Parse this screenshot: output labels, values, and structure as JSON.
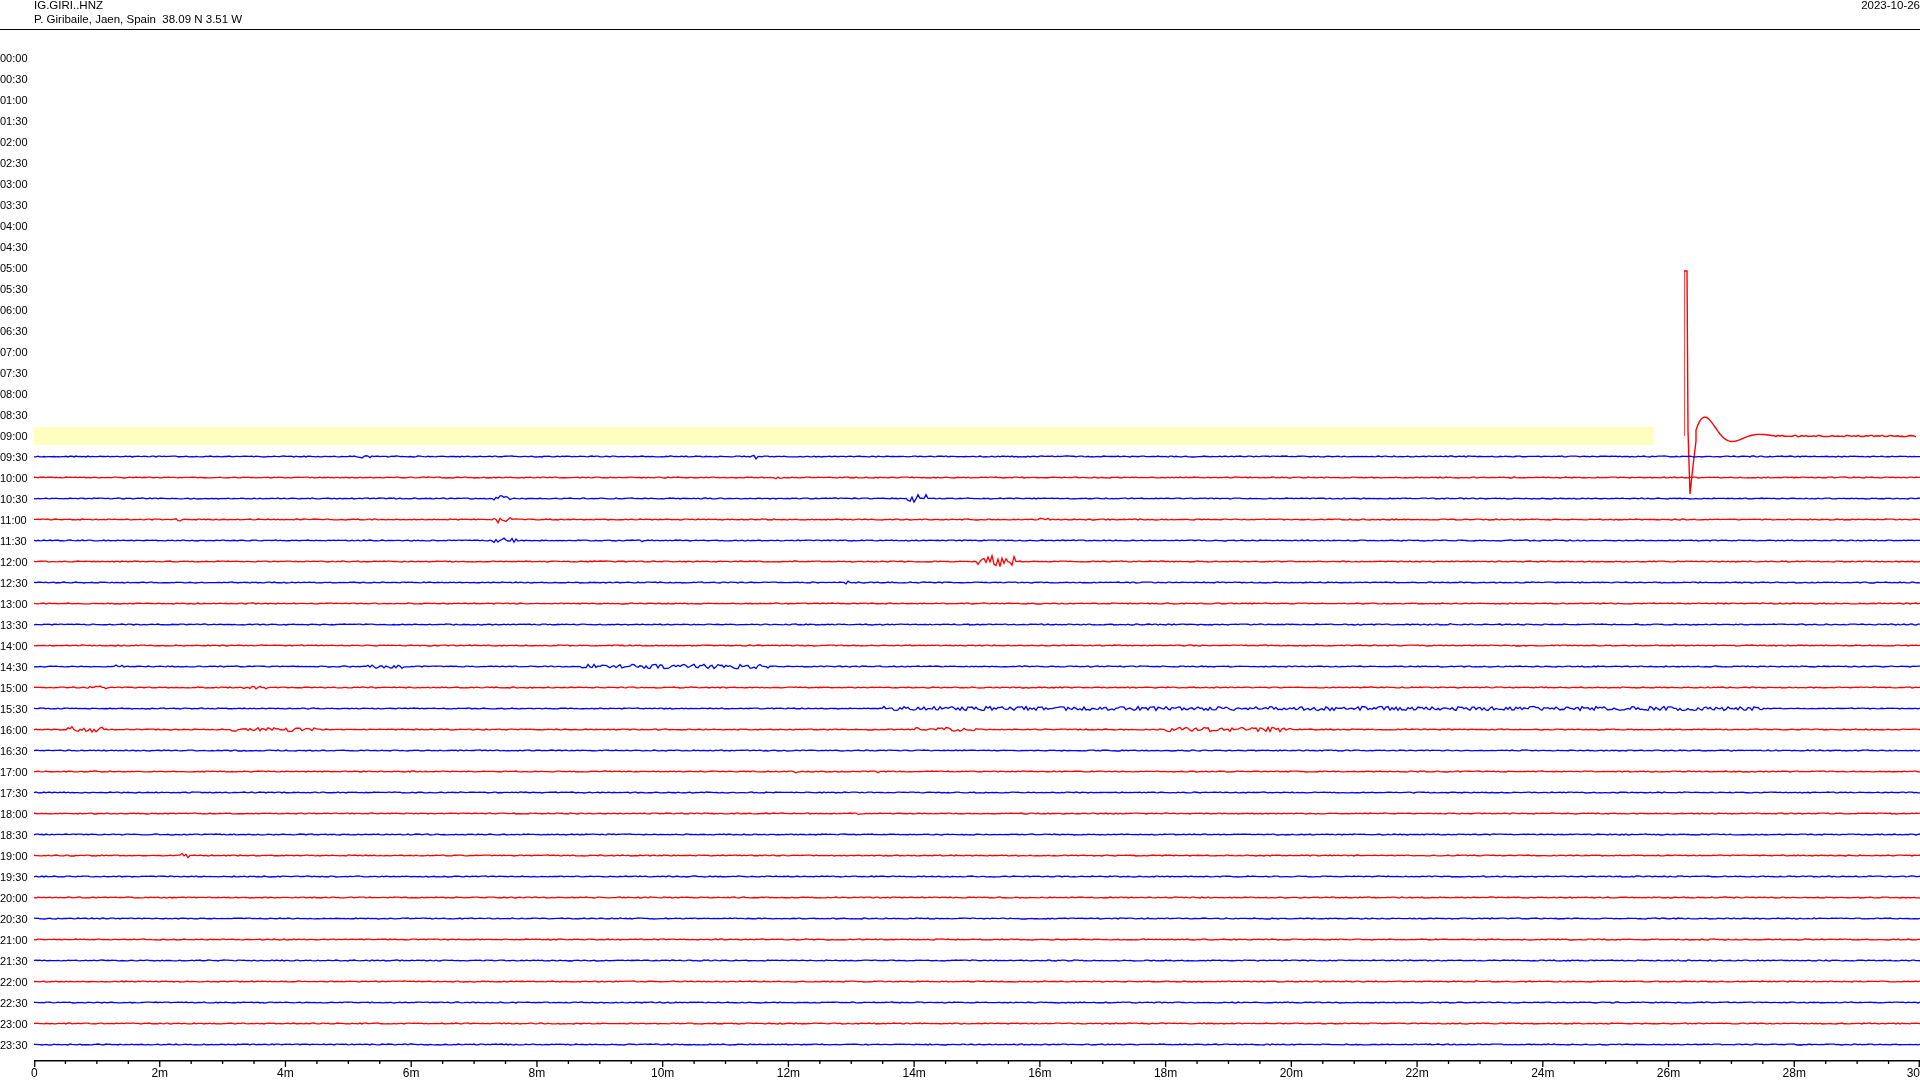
{
  "station": {
    "code": "IG.GIRI..HNZ",
    "location": "P. Giribaile, Jaen, Spain  38.09 N 3.51 W",
    "date": "2023-10-26"
  },
  "rows": [
    {
      "time": "00:00",
      "kind": "empty"
    },
    {
      "time": "00:30",
      "kind": "empty"
    },
    {
      "time": "01:00",
      "kind": "empty"
    },
    {
      "time": "01:30",
      "kind": "empty"
    },
    {
      "time": "02:00",
      "kind": "empty"
    },
    {
      "time": "02:30",
      "kind": "empty"
    },
    {
      "time": "03:00",
      "kind": "empty"
    },
    {
      "time": "03:30",
      "kind": "empty"
    },
    {
      "time": "04:00",
      "kind": "empty"
    },
    {
      "time": "04:30",
      "kind": "empty"
    },
    {
      "time": "05:00",
      "kind": "empty"
    },
    {
      "time": "05:30",
      "kind": "empty"
    },
    {
      "time": "06:00",
      "kind": "empty"
    },
    {
      "time": "06:30",
      "kind": "empty"
    },
    {
      "time": "07:00",
      "kind": "empty"
    },
    {
      "time": "07:30",
      "kind": "empty"
    },
    {
      "time": "08:00",
      "kind": "empty"
    },
    {
      "time": "08:30",
      "kind": "empty"
    },
    {
      "time": "09:00",
      "kind": "current",
      "color": "#ff0000"
    },
    {
      "time": "09:30",
      "kind": "trace",
      "color": "#0000ff"
    },
    {
      "time": "10:00",
      "kind": "trace",
      "color": "#ff0000"
    },
    {
      "time": "10:30",
      "kind": "trace",
      "color": "#0000ff"
    },
    {
      "time": "11:00",
      "kind": "trace",
      "color": "#ff0000"
    },
    {
      "time": "11:30",
      "kind": "trace",
      "color": "#0000ff"
    },
    {
      "time": "12:00",
      "kind": "trace",
      "color": "#ff0000"
    },
    {
      "time": "12:30",
      "kind": "trace",
      "color": "#0000ff"
    },
    {
      "time": "13:00",
      "kind": "trace",
      "color": "#ff0000"
    },
    {
      "time": "13:30",
      "kind": "trace",
      "color": "#0000ff"
    },
    {
      "time": "14:00",
      "kind": "trace",
      "color": "#ff0000"
    },
    {
      "time": "14:30",
      "kind": "trace",
      "color": "#0000ff"
    },
    {
      "time": "15:00",
      "kind": "trace",
      "color": "#ff0000"
    },
    {
      "time": "15:30",
      "kind": "trace",
      "color": "#0000ff"
    },
    {
      "time": "16:00",
      "kind": "trace",
      "color": "#ff0000"
    },
    {
      "time": "16:30",
      "kind": "trace",
      "color": "#0000ff"
    },
    {
      "time": "17:00",
      "kind": "trace",
      "color": "#ff0000"
    },
    {
      "time": "17:30",
      "kind": "trace",
      "color": "#0000ff"
    },
    {
      "time": "18:00",
      "kind": "trace",
      "color": "#ff0000"
    },
    {
      "time": "18:30",
      "kind": "trace",
      "color": "#0000ff"
    },
    {
      "time": "19:00",
      "kind": "trace",
      "color": "#ff0000"
    },
    {
      "time": "19:30",
      "kind": "trace",
      "color": "#0000ff"
    },
    {
      "time": "20:00",
      "kind": "trace",
      "color": "#ff0000"
    },
    {
      "time": "20:30",
      "kind": "trace",
      "color": "#0000ff"
    },
    {
      "time": "21:00",
      "kind": "trace",
      "color": "#ff0000"
    },
    {
      "time": "21:30",
      "kind": "trace",
      "color": "#0000ff"
    },
    {
      "time": "22:00",
      "kind": "trace",
      "color": "#ff0000"
    },
    {
      "time": "22:30",
      "kind": "trace",
      "color": "#0000ff"
    },
    {
      "time": "23:00",
      "kind": "trace",
      "color": "#ff0000"
    },
    {
      "time": "23:30",
      "kind": "trace",
      "color": "#0000ff"
    }
  ],
  "axis": {
    "ticks": [
      "0",
      "2m",
      "4m",
      "6m",
      "8m",
      "10m",
      "12m",
      "14m",
      "16m",
      "18m",
      "20m",
      "22m",
      "24m",
      "26m",
      "28m",
      "30"
    ]
  }
}
